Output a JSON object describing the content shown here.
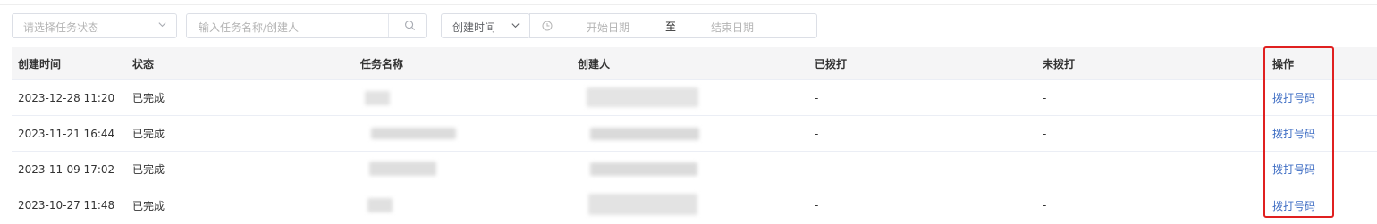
{
  "filters": {
    "status_placeholder": "请选择任务状态",
    "search_placeholder": "输入任务名称/创建人",
    "date_type": "创建时间",
    "date_start_placeholder": "开始日期",
    "date_separator": "至",
    "date_end_placeholder": "结束日期"
  },
  "table": {
    "headers": [
      "创建时间",
      "状态",
      "任务名称",
      "创建人",
      "已拨打",
      "未拨打",
      "操作"
    ],
    "rows": [
      {
        "created": "2023-12-28 11:20",
        "status": "已完成",
        "task": "",
        "creator": "",
        "dialed": "-",
        "undialed": "-",
        "action": "拨打号码"
      },
      {
        "created": "2023-11-21 16:44",
        "status": "已完成",
        "task": "",
        "creator": "",
        "dialed": "-",
        "undialed": "-",
        "action": "拨打号码"
      },
      {
        "created": "2023-11-09 17:02",
        "status": "已完成",
        "task": "",
        "creator": "",
        "dialed": "-",
        "undialed": "-",
        "action": "拨打号码"
      },
      {
        "created": "2023-10-27 11:48",
        "status": "已完成",
        "task": "",
        "creator": "",
        "dialed": "-",
        "undialed": "-",
        "action": "拨打号码"
      }
    ]
  },
  "icons": {
    "status_chevron": "chevron-down-icon",
    "search": "search-icon",
    "date_chevron": "chevron-down-icon",
    "clock": "clock-icon"
  },
  "colors": {
    "link": "#3f6ec4",
    "highlight": "#e02020",
    "header_bg": "#f5f5f6"
  }
}
